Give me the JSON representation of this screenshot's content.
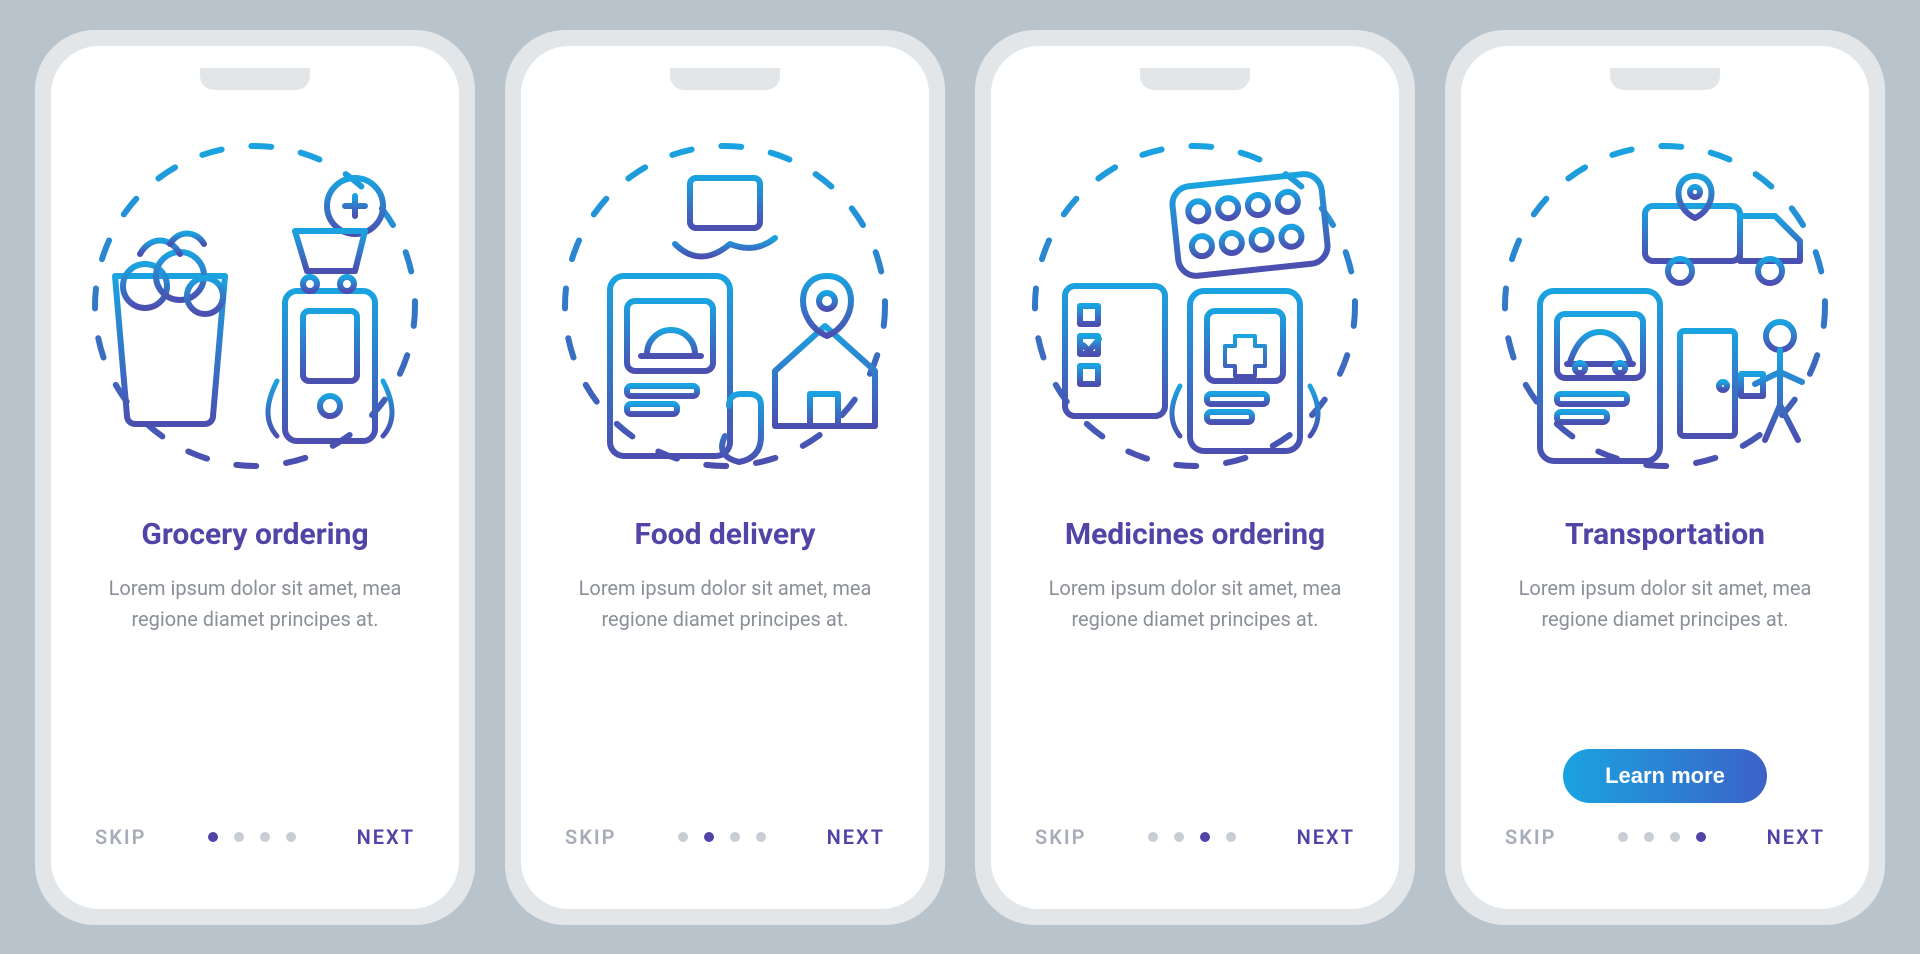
{
  "nav": {
    "skip": "SKIP",
    "next": "NEXT"
  },
  "body_text": "Lorem ipsum dolor sit amet, mea regione diamet principes at.",
  "cta_label": "Learn more",
  "screens": [
    {
      "title": "Grocery ordering",
      "icon": "grocery-icon",
      "active_dot": 0,
      "has_cta": false
    },
    {
      "title": "Food delivery",
      "icon": "food-icon",
      "active_dot": 1,
      "has_cta": false
    },
    {
      "title": "Medicines ordering",
      "icon": "medicine-icon",
      "active_dot": 2,
      "has_cta": false
    },
    {
      "title": "Transportation",
      "icon": "transport-icon",
      "active_dot": 3,
      "has_cta": true
    }
  ],
  "colors": {
    "accent": "#5044a7",
    "gradient_from": "#1aa3e0",
    "gradient_to": "#3c62c8"
  }
}
